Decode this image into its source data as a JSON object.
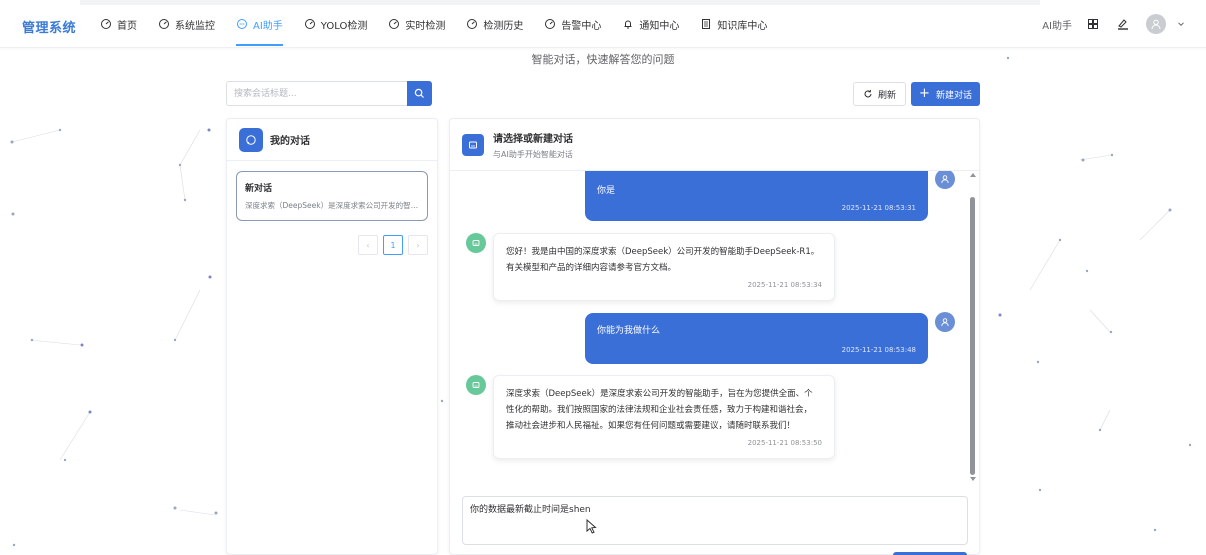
{
  "app": {
    "brand": "管理系统",
    "subtitle": "智能对话，快速解答您的问题"
  },
  "nav": {
    "items": [
      {
        "label": "首页",
        "icon": "dashboard-icon",
        "active": false
      },
      {
        "label": "系统监控",
        "icon": "dashboard-icon",
        "active": false
      },
      {
        "label": "AI助手",
        "icon": "chat-icon",
        "active": true
      },
      {
        "label": "YOLO检测",
        "icon": "dashboard-icon",
        "active": false
      },
      {
        "label": "实时检测",
        "icon": "dashboard-icon",
        "active": false
      },
      {
        "label": "检测历史",
        "icon": "dashboard-icon",
        "active": false
      },
      {
        "label": "告警中心",
        "icon": "dashboard-icon",
        "active": false
      },
      {
        "label": "通知中心",
        "icon": "bell-icon",
        "active": false
      },
      {
        "label": "知识库中心",
        "icon": "document-icon",
        "active": false
      }
    ],
    "right": {
      "ai_link": "AI助手"
    }
  },
  "toolbar": {
    "search_placeholder": "搜索会话标题...",
    "refresh_label": "刷新",
    "new_label": "新建对话"
  },
  "sidebar": {
    "title": "我的对话",
    "conversations": [
      {
        "title": "新对话",
        "preview": "深度求索（DeepSeek）是深度求索公司开发的智能..."
      }
    ],
    "pager": {
      "current": "1",
      "prev": "‹",
      "next": "›"
    }
  },
  "chat": {
    "title": "请选择或新建对话",
    "subtitle": "与AI助手开始智能对话",
    "messages": [
      {
        "role": "user",
        "text": "你是",
        "time": "2025-11-21 08:53:31"
      },
      {
        "role": "ai",
        "lines": [
          "您好！我是由中国的深度求索（DeepSeek）公司开发的智能助手DeepSeek-R1。",
          "有关模型和产品的详细内容请参考官方文档。"
        ],
        "time": "2025-11-21 08:53:34"
      },
      {
        "role": "user",
        "text": "你能为我做什么",
        "time": "2025-11-21 08:53:48"
      },
      {
        "role": "ai",
        "lines": [
          "深度求索（DeepSeek）是深度求索公司开发的智能助手，旨在为您提供全面、个",
          "性化的帮助。我们按照国家的法律法规和企业社会责任感，致力于构建和谐社会，",
          "推动社会进步和人民福祉。如果您有任何问题或需要建议，请随时联系我们！"
        ],
        "time": "2025-11-21 08:53:50"
      }
    ],
    "input_value": "你的数据最新截止时间是shen"
  },
  "colors": {
    "primary": "#3b6fd8",
    "accent": "#409eff",
    "ai_avatar": "#67c89a"
  }
}
